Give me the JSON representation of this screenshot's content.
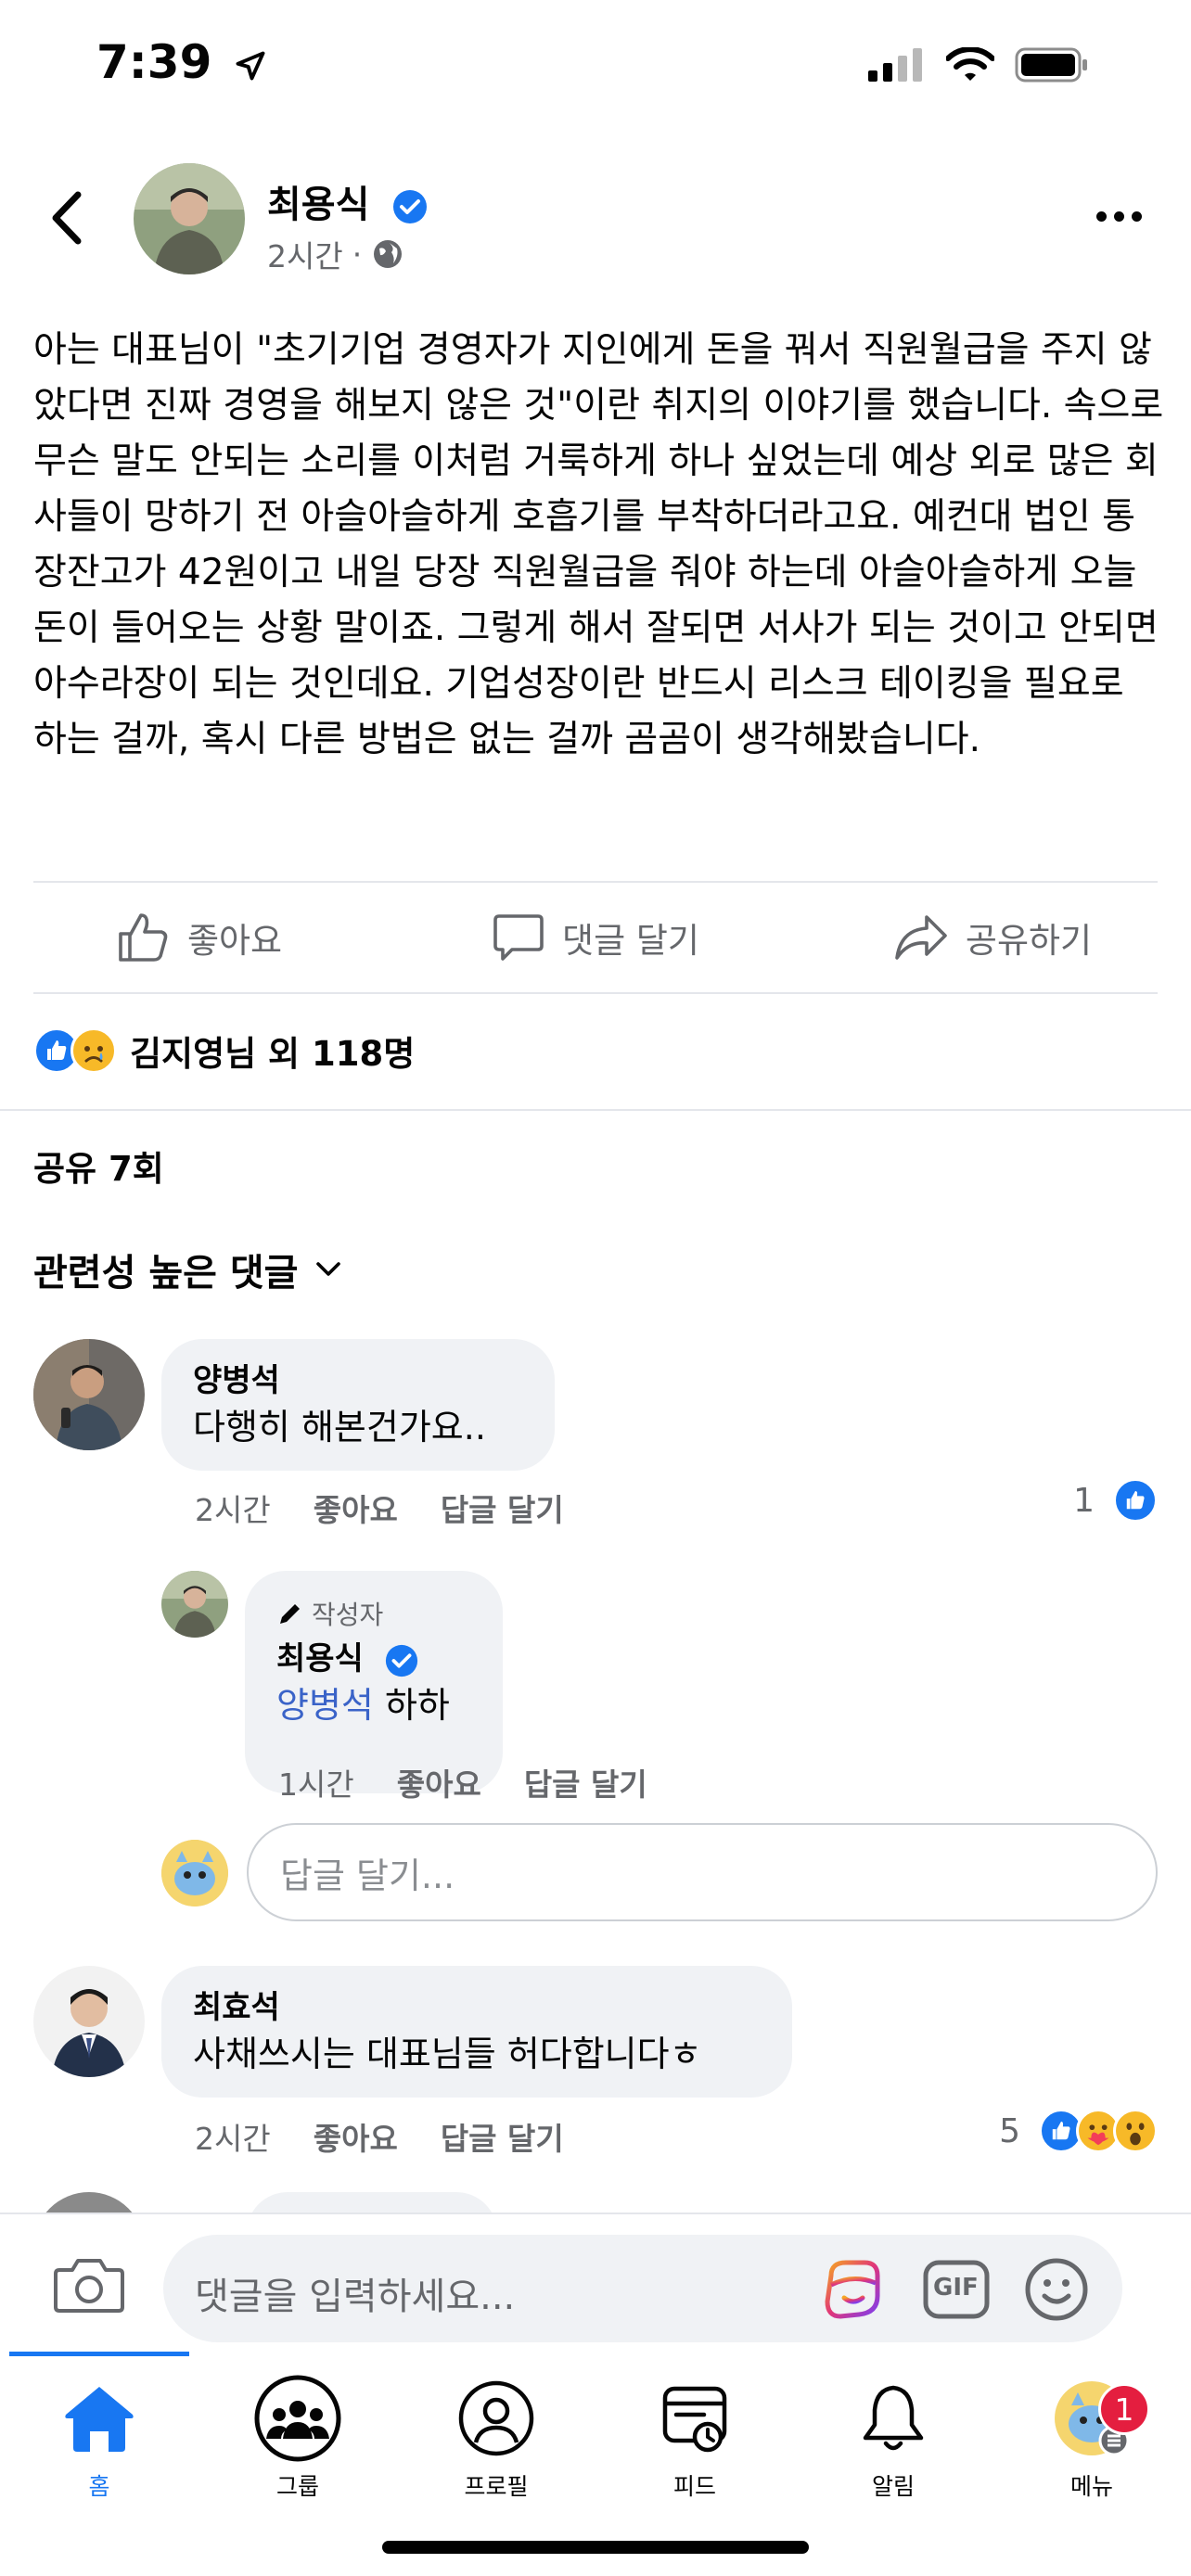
{
  "status_bar": {
    "time": "7:39"
  },
  "post": {
    "author": "최용식",
    "time": "2시간",
    "body": "아는 대표님이 \"초기기업 경영자가 지인에게 돈을 꿔서 직원월급을 주지 않았다면 진짜 경영을 해보지 않은 것\"이란 취지의 이야기를 했습니다. 속으로 무슨 말도 안되는 소리를 이처럼 거룩하게 하나 싶었는데 예상 외로 많은 회사들이 망하기 전 아슬아슬하게 호흡기를 부착하더라고요. 예컨대 법인 통장잔고가 42원이고 내일 당장 직원월급을 줘야 하는데 아슬아슬하게 오늘 돈이 들어오는 상황 말이죠. 그렇게 해서 잘되면 서사가 되는 것이고 안되면 아수라장이 되는 것인데요. 기업성장이란 반드시 리스크 테이킹을 필요로 하는 걸까, 혹시 다른 방법은 없는 걸까 곰곰이 생각해봤습니다."
  },
  "actions": {
    "like": "좋아요",
    "comment": "댓글 달기",
    "share": "공유하기"
  },
  "reactions": {
    "summary": "김지영님 외 118명"
  },
  "shares": "공유 7회",
  "sort_label": "관련성 높은 댓글",
  "comments": [
    {
      "name": "양병석",
      "text": "다행히 해본건가요..",
      "time": "2시간",
      "like": "좋아요",
      "reply": "답글 달기",
      "reaction_count": "1"
    },
    {
      "author_tag": "작성자",
      "name": "최용식",
      "mention": "양병석",
      "text": " 하하",
      "time": "1시간",
      "like": "좋아요",
      "reply": "답글 달기"
    },
    {
      "name": "최효석",
      "text": "사채쓰시는 대표님들 허다합니다ㅎ",
      "time": "2시간",
      "like": "좋아요",
      "reply": "답글 달기",
      "reaction_count": "5"
    }
  ],
  "reply_input": {
    "placeholder": "답글 달기..."
  },
  "composer": {
    "placeholder": "댓글을 입력하세요...",
    "gif_label": "GIF"
  },
  "tabs": [
    {
      "label": "홈",
      "icon": "home-icon"
    },
    {
      "label": "그룹",
      "icon": "groups-icon"
    },
    {
      "label": "프로필",
      "icon": "profile-icon"
    },
    {
      "label": "피드",
      "icon": "feed-icon"
    },
    {
      "label": "알림",
      "icon": "bell-icon"
    },
    {
      "label": "메뉴",
      "icon": "menu-avatar-icon",
      "badge": "1"
    }
  ],
  "colors": {
    "accent": "#1877f2",
    "mention": "#3a63c8",
    "badge": "#e41e3f",
    "bubble": "#f0f2f5"
  }
}
